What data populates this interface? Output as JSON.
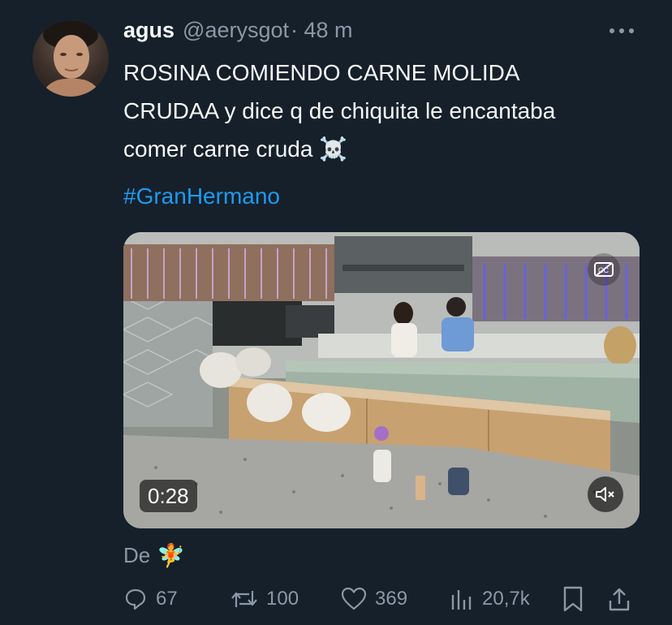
{
  "tweet": {
    "name": "agus",
    "handle": "@aerysgot",
    "time": "· 48 m",
    "more_icon": "more-horizontal-icon",
    "text_lines": [
      "ROSINA COMIENDO CARNE MOLIDA",
      "CRUDAA y dice q de chiquita le encantaba",
      "comer carne cruda ☠️"
    ],
    "hashtag": "#GranHermano"
  },
  "media": {
    "duration": "0:28",
    "mute_icon": "volume-muted-icon",
    "captions_icon": "closed-captions-icon",
    "scene": "kitchen-video-still"
  },
  "attribution": {
    "prefix": "De",
    "emoji": "🧚"
  },
  "actions": {
    "replies": "67",
    "retweets": "100",
    "likes": "369",
    "views": "20,7k"
  },
  "colors": {
    "background": "#15202b",
    "text": "#f7f9f9",
    "secondary": "#8b98a5",
    "accent": "#1d9bf0"
  }
}
